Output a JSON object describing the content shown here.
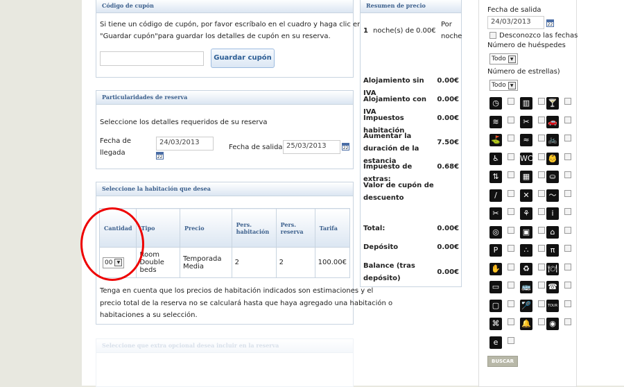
{
  "coupon": {
    "title": "Código de cupón",
    "text1": "Si tiene un código de cupón, por favor escríbalo en el cuadro y haga clic en",
    "text2": "\"Guardar cupón\"para guardar los detalles de cupón en su reserva.",
    "input_value": "",
    "button": "Guardar cupón"
  },
  "booking": {
    "title": "Particularidades de reserva",
    "intro": "Seleccione los detalles requeridos de su reserva",
    "arrival_label_1": "Fecha de",
    "arrival_label_2": "llegada",
    "arrival_value": "24/03/2013",
    "departure_label": "Fecha de salida",
    "departure_value": "25/03/2013"
  },
  "rooms": {
    "title": "Seleccione la habitación que desea",
    "headers": [
      "Cantidad",
      "Tipo",
      "Precio",
      "Pers. habitación",
      "Pers. reserva",
      "Tarifa"
    ],
    "row": {
      "qty": "00",
      "tipo": "Room Double beds",
      "precio": "Temporada Media",
      "pers_hab": "2",
      "pers_res": "2",
      "tarifa": "100.00€"
    },
    "note": [
      "Tenga en cuenta que los precios de habitación indicados son estimaciones y el",
      "precio total de la reserva no se calculará hasta que haya agregado una habitación o",
      "habitaciones a su selección."
    ],
    "faded_title": "Seleccione que extra opcional desea incluir en la reserva"
  },
  "summary": {
    "title": "Resumen de precio",
    "nights_num": "1",
    "nights_text": "noche(s) de",
    "nights_price": "0.00€",
    "por": "Por",
    "noche": "noche",
    "rows": [
      {
        "label": "Alojamiento sin IVA",
        "value": "0.00€"
      },
      {
        "label": "Alojamiento con IVA",
        "value": "0.00€"
      },
      {
        "label": "Impuestos habitación",
        "value": "0.00€"
      },
      {
        "label": "Aumentar la duración de la estancia",
        "value": "7.50€"
      },
      {
        "label": "Impuesto de extras:",
        "value": "0.68€"
      },
      {
        "label": "Valor de cupón de descuento",
        "value": ""
      },
      {
        "label": "Total:",
        "value": "0.00€"
      },
      {
        "label": "Depósito",
        "value": "0.00€"
      },
      {
        "label": "Balance (tras depósito)",
        "value": "0.00€"
      }
    ]
  },
  "search": {
    "exit_label": "Fecha de salida",
    "exit_value": "24/03/2013",
    "unknown_dates": "Desconozco las fechas",
    "guests_label": "Número de huéspedes",
    "guests_value": "Todo",
    "stars_label": "Número de estrellas)",
    "stars_value": "Todo",
    "button": "BUSCAR",
    "icons": [
      "clock-icon",
      "spa-icon",
      "bar-icon",
      "pool-icon",
      "hairdryer-icon",
      "car-icon",
      "golf-icon",
      "dive-icon",
      "bicycle-icon",
      "wheelchair-icon",
      "wc-icon",
      "baby-icon",
      "elevator-icon",
      "grid-icon",
      "stroller-icon",
      "tennis-icon",
      "crossed-tools-icon",
      "swim-icon",
      "hairdryer2-icon",
      "hiking-icon",
      "info-icon",
      "target-icon",
      "building-icon",
      "house-icon",
      "parking-icon",
      "dots-icon",
      "picnic-icon",
      "massage-icon",
      "recycle-icon",
      "restaurant-icon",
      "tv-icon",
      "bus-icon",
      "phone-icon",
      "monitor-icon",
      "tennis2-icon",
      "tour-icon",
      "laundry-icon",
      "bell-icon",
      "wifi-icon",
      "www-icon"
    ],
    "glyphs": [
      "◷",
      "▥",
      "🍸",
      "≋",
      "✂",
      "🚗",
      "⛳",
      "≈",
      "🚲",
      "♿",
      "WC",
      "👶",
      "⇅",
      "▦",
      "⛀",
      "/",
      "✕",
      "〜",
      "✂",
      "⚘",
      "i",
      "◎",
      "▣",
      "⌂",
      "P",
      "∴",
      "π",
      "✋",
      "♻",
      "🍽",
      "▭",
      "🚌",
      "☎",
      "▢",
      "🏸",
      "TOUR",
      "⌘",
      "🔔",
      "◉",
      "e"
    ]
  }
}
